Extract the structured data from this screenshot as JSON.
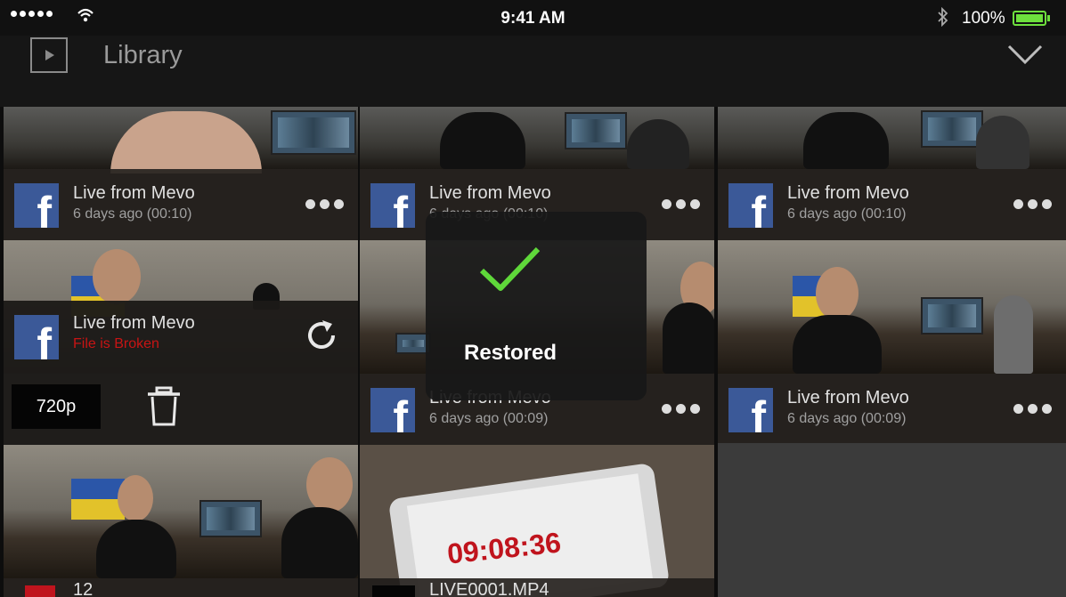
{
  "status_bar": {
    "time": "9:41 AM",
    "battery_percent": "100%"
  },
  "nav": {
    "title": "Library"
  },
  "items": [
    {
      "title": "Live from Mevo",
      "meta": "6 days ago (00:10)"
    },
    {
      "title": "Live from Mevo",
      "meta": "6 days ago (00:10)"
    },
    {
      "title": "Live from Mevo",
      "meta": "6 days ago (00:10)"
    },
    {
      "title": "Live from Mevo",
      "meta": "File is Broken"
    },
    {
      "title": "Live from Mevo",
      "meta": "6 days ago (00:09)"
    },
    {
      "title": "Live from Mevo",
      "meta": "6 days ago (00:09)"
    },
    {
      "title": "12",
      "meta": ""
    },
    {
      "title": "LIVE0001.MP4",
      "meta": ""
    }
  ],
  "broken_actions": {
    "resolution": "720p"
  },
  "toast": {
    "message": "Restored"
  },
  "thumbnail_text": {
    "clock": "09:08:36"
  },
  "colors": {
    "accent_green": "#6ee03d",
    "facebook_blue": "#3b5998",
    "error_red": "#c81414",
    "check_green": "#5fd83a"
  },
  "icons": {
    "play": "play-square-icon",
    "collapse": "chevron-down-icon",
    "more": "more-dots-icon",
    "retry": "refresh-icon",
    "delete": "trash-icon",
    "success": "checkmark-icon"
  }
}
